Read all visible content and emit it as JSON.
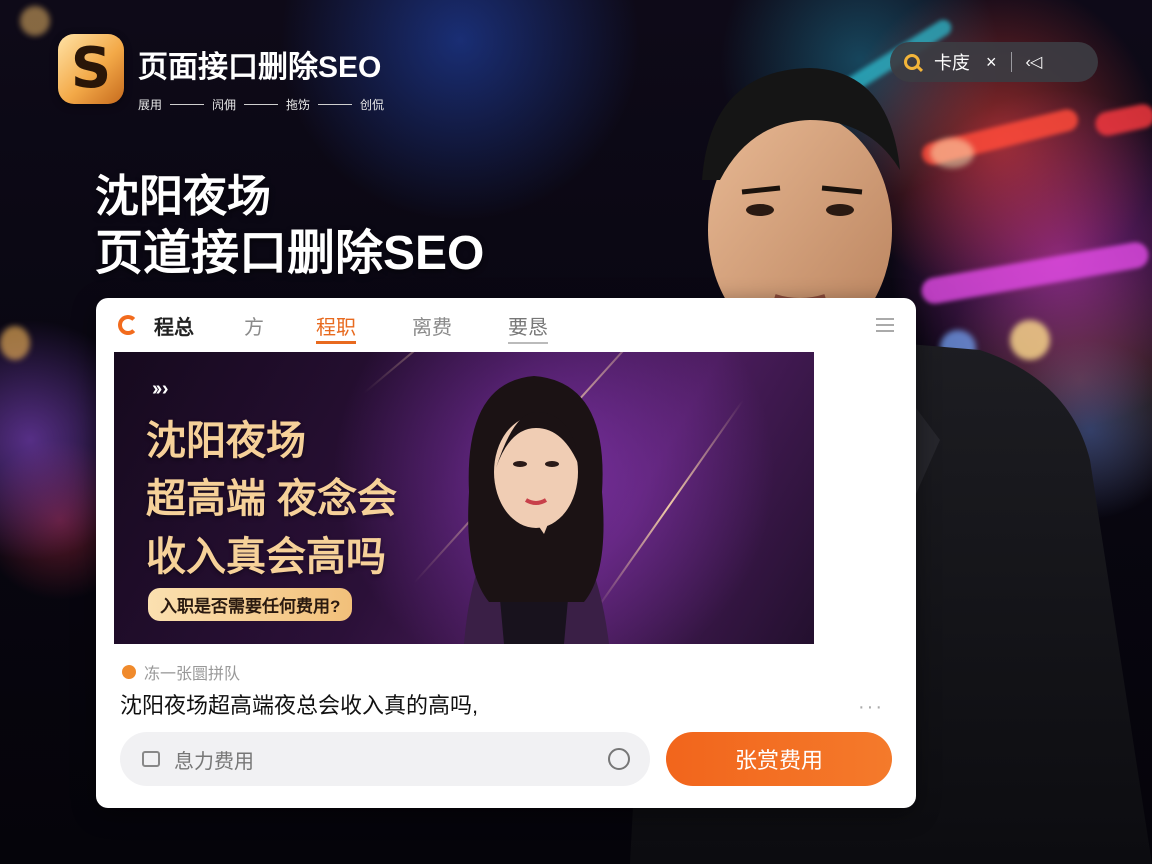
{
  "logo": {
    "mark": "S",
    "title": "页面接口删除SEO",
    "tagline": [
      "展用",
      "闶佣",
      "拖饬",
      "创侃"
    ]
  },
  "search_pill": {
    "text": "卡庋",
    "close": "×",
    "back": "‹◁"
  },
  "hero": {
    "line1": "沈阳夜场",
    "line2": "页道接口删除SEO"
  },
  "card": {
    "brand": "程总",
    "tabs": [
      "方",
      "程职",
      "离费",
      "要恳"
    ],
    "active_tab": "程职",
    "banner": {
      "chevrons": "›› ›",
      "lines": [
        "沈阳夜场",
        "超高端 夜念会",
        "收入真会高吗"
      ],
      "tag": "入职是否需要任何费用?"
    },
    "meta": "冻一张圜拼队",
    "question": "沈阳夜场超高端夜总会收入真的高吗,",
    "more": "···",
    "input_placeholder": "息力费用",
    "cta_label": "张赏费用"
  },
  "colors": {
    "accent": "#f2651c",
    "gold": "#f6d199",
    "pill_icon": "#f2b53a"
  }
}
